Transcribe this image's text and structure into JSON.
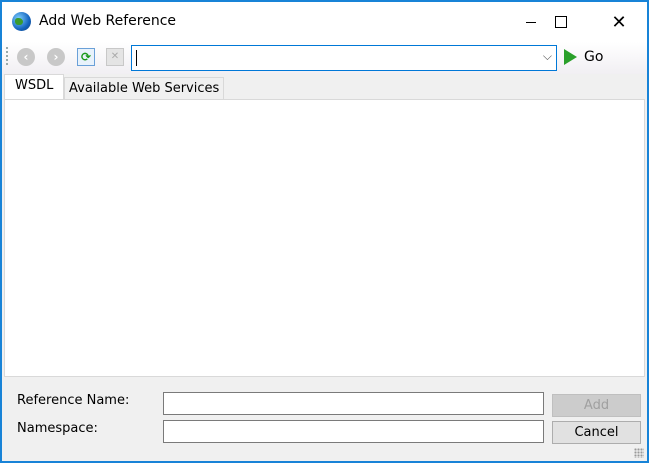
{
  "window": {
    "title": "Add Web Reference",
    "minimize_icon": "minimize-icon",
    "maximize_icon": "maximize-icon",
    "close_icon": "close-icon"
  },
  "toolbar": {
    "back_icon": "back-icon",
    "forward_icon": "forward-icon",
    "refresh_icon": "refresh-icon",
    "stop_icon": "stop-icon",
    "url_value": "",
    "go_label": "Go"
  },
  "tabs": [
    {
      "label": "WSDL",
      "active": true
    },
    {
      "label": "Available Web Services",
      "active": false
    }
  ],
  "form": {
    "reference_name_label": "Reference Name:",
    "reference_name_value": "",
    "namespace_label": "Namespace:",
    "namespace_value": "",
    "add_label": "Add",
    "cancel_label": "Cancel"
  },
  "colors": {
    "border": "#1883d7",
    "go": "#2aa02a"
  }
}
